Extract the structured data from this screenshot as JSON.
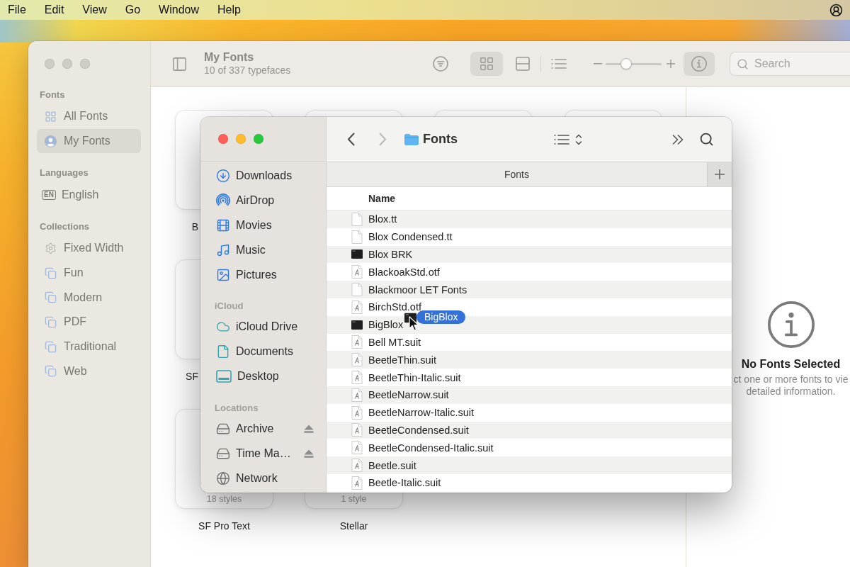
{
  "menu_bar": {
    "items": [
      "File",
      "Edit",
      "View",
      "Go",
      "Window",
      "Help"
    ]
  },
  "font_book": {
    "active": false,
    "sidebar": {
      "sections": [
        {
          "title": "Fonts",
          "items": [
            {
              "label": "All Fonts",
              "kind": "grid",
              "selected": false
            },
            {
              "label": "My Fonts",
              "kind": "user",
              "selected": true
            }
          ]
        },
        {
          "title": "Languages",
          "items": [
            {
              "label": "English",
              "kind": "language",
              "badge": "EN",
              "selected": false
            }
          ]
        },
        {
          "title": "Collections",
          "items": [
            {
              "label": "Fixed Width",
              "kind": "smart",
              "selected": false
            },
            {
              "label": "Fun",
              "kind": "collection",
              "selected": false
            },
            {
              "label": "Modern",
              "kind": "collection",
              "selected": false
            },
            {
              "label": "PDF",
              "kind": "collection",
              "selected": false
            },
            {
              "label": "Traditional",
              "kind": "collection",
              "selected": false
            },
            {
              "label": "Web",
              "kind": "collection",
              "selected": false
            }
          ]
        }
      ]
    },
    "toolbar": {
      "title": "My Fonts",
      "subtitle": "10 of 337 typefaces",
      "views": [
        {
          "kind": "grid",
          "selected": true
        },
        {
          "kind": "rows",
          "selected": false
        },
        {
          "kind": "list",
          "selected": false
        }
      ],
      "zoom": {
        "level": 0.37
      },
      "info": {
        "selected": true
      },
      "search": {
        "placeholder": "Search"
      }
    },
    "font_cards": [
      [
        {
          "name": "B",
          "selected": false
        },
        {
          "selected": false
        },
        {
          "selected": false
        },
        {
          "selected": false
        }
      ],
      [
        {
          "name": "SF",
          "selected": false
        }
      ],
      [
        {
          "name": "SF Pro Text",
          "styles": "18 styles",
          "selected": false
        },
        {
          "name": "Stellar",
          "styles": "1 style",
          "selected": false
        }
      ]
    ],
    "info_panel": {
      "title": "No Fonts Selected",
      "lines": [
        "ct one or more fonts to vie",
        "detailed information."
      ]
    }
  },
  "finder": {
    "active": true,
    "sidebar": {
      "sections": [
        {
          "items": [
            {
              "label": "Downloads",
              "kind": "downloads",
              "selected": false
            },
            {
              "label": "AirDrop",
              "kind": "airdrop",
              "selected": false
            },
            {
              "label": "Movies",
              "kind": "movies",
              "selected": false
            },
            {
              "label": "Music",
              "kind": "music",
              "selected": false
            },
            {
              "label": "Pictures",
              "kind": "pictures",
              "selected": false
            }
          ]
        },
        {
          "title": "iCloud",
          "items": [
            {
              "label": "iCloud Drive",
              "kind": "cloud",
              "selected": false
            },
            {
              "label": "Documents",
              "kind": "document",
              "selected": false
            },
            {
              "label": "Desktop",
              "kind": "desktop",
              "selected": false
            }
          ]
        },
        {
          "title": "Locations",
          "items": [
            {
              "label": "Archive",
              "kind": "drive",
              "ejectable": true,
              "selected": false
            },
            {
              "label": "Time Ma…",
              "kind": "drive",
              "ejectable": true,
              "selected": false
            },
            {
              "label": "Network",
              "kind": "network",
              "ejectable": false,
              "selected": false
            }
          ]
        }
      ]
    },
    "toolbar": {
      "back": {
        "disabled": false
      },
      "forward": {
        "disabled": true
      },
      "title": "Fonts"
    },
    "tabs": [
      {
        "label": "Fonts",
        "selected": true
      }
    ],
    "columns": [
      "Name"
    ],
    "files": [
      {
        "name": "Blox.tt",
        "kind": "document",
        "selected": false
      },
      {
        "name": "Blox Condensed.tt",
        "kind": "document",
        "selected": false
      },
      {
        "name": "Blox BRK",
        "kind": "executable",
        "selected": false
      },
      {
        "name": "BlackoakStd.otf",
        "kind": "font",
        "selected": false
      },
      {
        "name": "Blackmoor LET Fonts",
        "kind": "document",
        "selected": false
      },
      {
        "name": "BirchStd.otf",
        "kind": "font",
        "selected": false
      },
      {
        "name": "BigBlox",
        "kind": "executable",
        "selected": false
      },
      {
        "name": "Bell MT.suit",
        "kind": "font",
        "selected": false
      },
      {
        "name": "BeetleThin.suit",
        "kind": "font",
        "selected": false
      },
      {
        "name": "BeetleThin-Italic.suit",
        "kind": "font",
        "selected": false
      },
      {
        "name": "BeetleNarrow.suit",
        "kind": "font",
        "selected": false
      },
      {
        "name": "BeetleNarrow-Italic.suit",
        "kind": "font",
        "selected": false
      },
      {
        "name": "BeetleCondensed.suit",
        "kind": "font",
        "selected": false
      },
      {
        "name": "BeetleCondensed-Italic.suit",
        "kind": "font",
        "selected": false
      },
      {
        "name": "Beetle.suit",
        "kind": "font",
        "selected": false
      },
      {
        "name": "Beetle-Italic.suit",
        "kind": "font",
        "selected": false
      }
    ],
    "drag": {
      "label": "BigBlox"
    }
  }
}
